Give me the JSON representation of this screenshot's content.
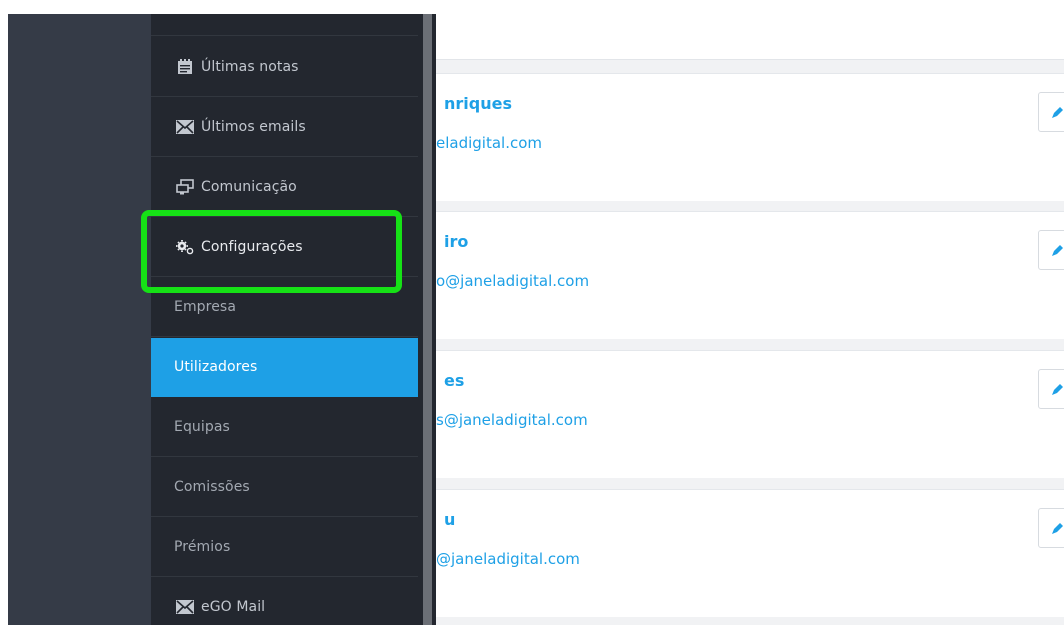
{
  "menu": {
    "items": [
      {
        "label": "Últimas notas",
        "icon": "notes-icon"
      },
      {
        "label": "Últimos emails",
        "icon": "envelope-icon"
      },
      {
        "label": "Comunicação",
        "icon": "chat-windows-icon"
      },
      {
        "label": "Configurações",
        "icon": "gears-icon"
      }
    ],
    "settings_sub": [
      "Empresa",
      "Utilizadores",
      "Equipas",
      "Comissões",
      "Prémios"
    ],
    "bottom_item": {
      "label": "eGO Mail",
      "icon": "envelope-icon"
    }
  },
  "users": [
    {
      "name_fragment": "nriques",
      "email_fragment": "eladigital.com"
    },
    {
      "name_fragment": "iro",
      "email_fragment": "o@janeladigital.com"
    },
    {
      "name_fragment": "es",
      "email_fragment": "s@janeladigital.com"
    },
    {
      "name_fragment": "u",
      "email_fragment": "@janeladigital.com"
    }
  ],
  "colors": {
    "accent": "#1ea0e6",
    "highlight": "#16e116",
    "menu_bg": "#23272f",
    "rail_bg": "#353b47"
  }
}
